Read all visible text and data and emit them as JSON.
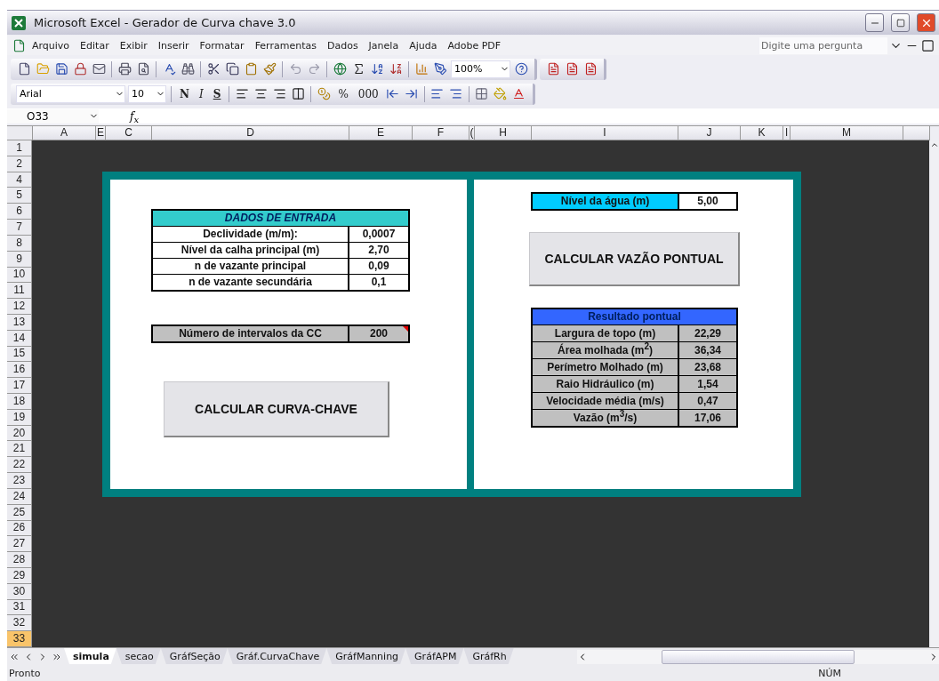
{
  "window": {
    "title": "Microsoft Excel - Gerador de Curva chave 3.0"
  },
  "menu": [
    "Arquivo",
    "Editar",
    "Exibir",
    "Inserir",
    "Formatar",
    "Ferramentas",
    "Dados",
    "Janela",
    "Ajuda",
    "Adobe PDF"
  ],
  "help_search": {
    "placeholder": "Digite uma pergunta"
  },
  "standard_toolbar": {
    "zoom": "100%"
  },
  "formatting_toolbar": {
    "font": "Arial",
    "size": "10",
    "buttons": [
      "N",
      "I",
      "S",
      "%",
      "000"
    ]
  },
  "formula_bar": {
    "name_box": "O33",
    "fx": "f$_{x}$"
  },
  "columns": [
    "A",
    "E",
    "C",
    "D",
    "E",
    "F",
    "(",
    "H",
    "I",
    "J",
    "K",
    "l",
    "M"
  ],
  "rows": [
    {
      "label": "1",
      "selected": false
    },
    {
      "label": "2",
      "selected": false
    },
    {
      "label": "4",
      "selected": false
    },
    {
      "label": "5",
      "selected": false
    },
    {
      "label": "6",
      "selected": false
    },
    {
      "label": "7",
      "selected": false
    },
    {
      "label": "8",
      "selected": false
    },
    {
      "label": "9",
      "selected": false
    },
    {
      "label": "10",
      "selected": false
    },
    {
      "label": "11",
      "selected": false
    },
    {
      "label": "12",
      "selected": false
    },
    {
      "label": "13",
      "selected": false
    },
    {
      "label": "14",
      "selected": false
    },
    {
      "label": "15",
      "selected": false
    },
    {
      "label": "16",
      "selected": false
    },
    {
      "label": "17",
      "selected": false
    },
    {
      "label": "18",
      "selected": false
    },
    {
      "label": "19",
      "selected": false
    },
    {
      "label": "20",
      "selected": false
    },
    {
      "label": "21",
      "selected": false
    },
    {
      "label": "22",
      "selected": false
    },
    {
      "label": "23",
      "selected": false
    },
    {
      "label": "24",
      "selected": false
    },
    {
      "label": "25",
      "selected": false
    },
    {
      "label": "26",
      "selected": false
    },
    {
      "label": "27",
      "selected": false
    },
    {
      "label": "28",
      "selected": false
    },
    {
      "label": "29",
      "selected": false
    },
    {
      "label": "30",
      "selected": false
    },
    {
      "label": "31",
      "selected": false
    },
    {
      "label": "32",
      "selected": false
    },
    {
      "label": "33",
      "selected": true
    }
  ],
  "input_table": {
    "title": "DADOS DE ENTRADA",
    "rows": [
      {
        "label": "Declividade (m/m):",
        "value": "0,0007"
      },
      {
        "label": "Nível da calha principal (m)",
        "value": "2,70"
      },
      {
        "label": "n de vazante principal",
        "value": "0,09"
      },
      {
        "label": "n de vazante secundária",
        "value": "0,1"
      }
    ]
  },
  "intervals": {
    "label": "Número de intervalos da CC",
    "value": "200",
    "has_comment": true
  },
  "curve_button": "CALCULAR CURVA-CHAVE",
  "water_level": {
    "label": "Nível da água (m)",
    "value": "5,00"
  },
  "point_button": "CALCULAR VAZÃO PONTUAL",
  "result_table": {
    "title": "Resultado pontual",
    "rows": [
      {
        "label": "Largura de topo (m)",
        "value": "22,29"
      },
      {
        "label": "Área molhada (m$^{2}$)",
        "value": "36,34"
      },
      {
        "label": "Perímetro Molhado (m)",
        "value": "23,68"
      },
      {
        "label": "Raio Hidráulico (m)",
        "value": "1,54"
      },
      {
        "label": "Velocidade média (m/s)",
        "value": "0,47"
      },
      {
        "label": "Vazão (m$^{3}$/s)",
        "value": "17,06"
      }
    ]
  },
  "sheet_tabs": [
    {
      "label": "simula",
      "selected": true
    },
    {
      "label": "secao",
      "selected": false
    },
    {
      "label": "GráfSeção",
      "selected": false
    },
    {
      "label": "Gráf.CurvaChave",
      "selected": false
    },
    {
      "label": "GráfManning",
      "selected": false
    },
    {
      "label": "GráfAPM",
      "selected": false
    },
    {
      "label": "GráfRh",
      "selected": false
    }
  ],
  "status_bar": {
    "status": "Pronto",
    "num_lock": "NÚM"
  }
}
